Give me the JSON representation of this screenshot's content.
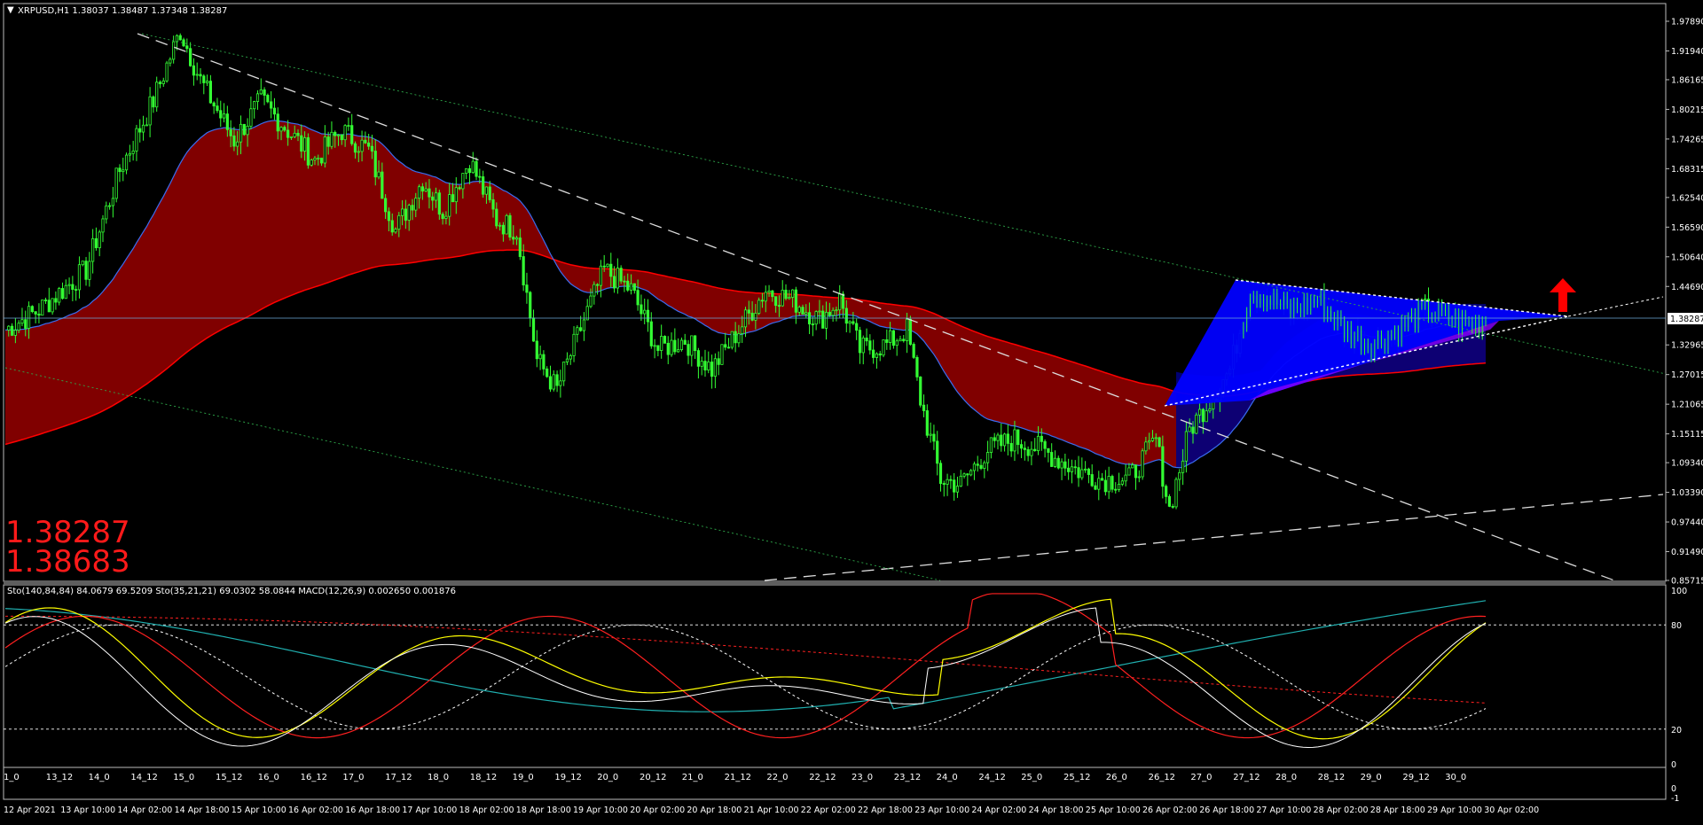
{
  "symbol_header": "XRPUSD,H1  1.38037 1.38487 1.37348 1.38287",
  "indicator_header": "Sto(140,84,84) 84.0679 69.5209  Sto(35,21,21) 69.0302 58.0844  MACD(12,26,9) 0.002650 0.001876",
  "big_prices": [
    "1.38287",
    "1.38683"
  ],
  "current_price_label": "1.38287",
  "colors": {
    "candle": "#33ff33",
    "cloud_red": "#800000",
    "cloud_blue": "#0000ff",
    "cloud_violet": "#8800ff",
    "ma_red": "#ff0000",
    "ma_blue": "#3a6df0",
    "arrow": "#ff0000",
    "osc_yellow": "#ffff00",
    "osc_red": "#ff2020",
    "osc_white": "#ffffff",
    "osc_teal": "#20b0b0"
  },
  "icons": {
    "arrow": "red-up-arrow-icon",
    "menu": "dropdown-triangle-icon"
  },
  "chart_data": {
    "type": "candlestick",
    "title": "XRPUSD,H1",
    "price_axis_ticks": [
      "1.97890",
      "1.91940",
      "1.86165",
      "1.80215",
      "1.74265",
      "1.68315",
      "1.62540",
      "1.56590",
      "1.50640",
      "1.44690",
      "1.38287",
      "1.32965",
      "1.27015",
      "1.21065",
      "1.15115",
      "1.09340",
      "1.03390",
      "0.97440",
      "0.91490",
      "0.85715"
    ],
    "indicator_axis_ticks": [
      "100",
      "80",
      "20",
      "0"
    ],
    "macd_axis_ticks": [
      "0",
      "-1"
    ],
    "time_ticks_top": [
      "1_0",
      "13_12",
      "14_0",
      "14_12",
      "15_0",
      "15_12",
      "16_0",
      "16_12",
      "17_0",
      "17_12",
      "18_0",
      "18_12",
      "19_0",
      "19_12",
      "20_0",
      "20_12",
      "21_0",
      "21_12",
      "22_0",
      "22_12",
      "23_0",
      "23_12",
      "24_0",
      "24_12",
      "25_0",
      "25_12",
      "26_0",
      "26_12",
      "27_0",
      "27_12",
      "28_0",
      "28_12",
      "29_0",
      "29_12",
      "30_0"
    ],
    "time_ticks_bottom": [
      "12 Apr 2021",
      "13 Apr 10:00",
      "14 Apr 02:00",
      "14 Apr 18:00",
      "15 Apr 10:00",
      "16 Apr 02:00",
      "16 Apr 18:00",
      "17 Apr 10:00",
      "18 Apr 02:00",
      "18 Apr 18:00",
      "19 Apr 10:00",
      "20 Apr 02:00",
      "20 Apr 18:00",
      "21 Apr 10:00",
      "22 Apr 02:00",
      "22 Apr 18:00",
      "23 Apr 10:00",
      "24 Apr 02:00",
      "24 Apr 18:00",
      "25 Apr 10:00",
      "26 Apr 02:00",
      "26 Apr 18:00",
      "27 Apr 10:00",
      "28 Apr 02:00",
      "28 Apr 18:00",
      "29 Apr 10:00",
      "30 Apr 02:00"
    ],
    "close_anchors": [
      [
        "12 Apr 00:00",
        1.36
      ],
      [
        "12 Apr 10:00",
        1.4
      ],
      [
        "13 Apr 00:00",
        1.48
      ],
      [
        "13 Apr 10:00",
        1.68
      ],
      [
        "13 Apr 20:00",
        1.82
      ],
      [
        "14 Apr 04:00",
        1.96
      ],
      [
        "14 Apr 10:00",
        1.86
      ],
      [
        "14 Apr 20:00",
        1.74
      ],
      [
        "15 Apr 04:00",
        1.82
      ],
      [
        "15 Apr 12:00",
        1.76
      ],
      [
        "15 Apr 20:00",
        1.7
      ],
      [
        "16 Apr 04:00",
        1.76
      ],
      [
        "16 Apr 12:00",
        1.72
      ],
      [
        "16 Apr 20:00",
        1.56
      ],
      [
        "17 Apr 04:00",
        1.66
      ],
      [
        "17 Apr 10:00",
        1.6
      ],
      [
        "17 Apr 18:00",
        1.7
      ],
      [
        "18 Apr 02:00",
        1.58
      ],
      [
        "18 Apr 08:00",
        1.56
      ],
      [
        "18 Apr 14:00",
        1.3
      ],
      [
        "18 Apr 20:00",
        1.24
      ],
      [
        "19 Apr 04:00",
        1.38
      ],
      [
        "19 Apr 10:00",
        1.48
      ],
      [
        "19 Apr 18:00",
        1.44
      ],
      [
        "20 Apr 02:00",
        1.32
      ],
      [
        "20 Apr 10:00",
        1.34
      ],
      [
        "20 Apr 18:00",
        1.28
      ],
      [
        "21 Apr 02:00",
        1.36
      ],
      [
        "21 Apr 10:00",
        1.44
      ],
      [
        "21 Apr 18:00",
        1.42
      ],
      [
        "22 Apr 02:00",
        1.38
      ],
      [
        "22 Apr 08:00",
        1.42
      ],
      [
        "22 Apr 14:00",
        1.32
      ],
      [
        "22 Apr 22:00",
        1.33
      ],
      [
        "23 Apr 04:00",
        1.36
      ],
      [
        "23 Apr 08:00",
        1.22
      ],
      [
        "23 Apr 14:00",
        1.06
      ],
      [
        "23 Apr 20:00",
        1.05
      ],
      [
        "24 Apr 04:00",
        1.12
      ],
      [
        "24 Apr 12:00",
        1.14
      ],
      [
        "24 Apr 20:00",
        1.12
      ],
      [
        "25 Apr 06:00",
        1.08
      ],
      [
        "25 Apr 14:00",
        1.06
      ],
      [
        "25 Apr 22:00",
        1.06
      ],
      [
        "26 Apr 06:00",
        1.14
      ],
      [
        "26 Apr 10:00",
        1.0
      ],
      [
        "26 Apr 16:00",
        1.16
      ],
      [
        "26 Apr 22:00",
        1.22
      ],
      [
        "27 Apr 04:00",
        1.28
      ],
      [
        "27 Apr 10:00",
        1.44
      ],
      [
        "27 Apr 16:00",
        1.42
      ],
      [
        "27 Apr 22:00",
        1.4
      ],
      [
        "28 Apr 06:00",
        1.42
      ],
      [
        "28 Apr 14:00",
        1.36
      ],
      [
        "28 Apr 22:00",
        1.33
      ],
      [
        "29 Apr 06:00",
        1.36
      ],
      [
        "29 Apr 14:00",
        1.4
      ],
      [
        "29 Apr 22:00",
        1.38
      ],
      [
        "30 Apr 04:00",
        1.37
      ],
      [
        "30 Apr 08:00",
        1.383
      ]
    ],
    "annotations": [
      "1.38287",
      "1.38683"
    ]
  }
}
